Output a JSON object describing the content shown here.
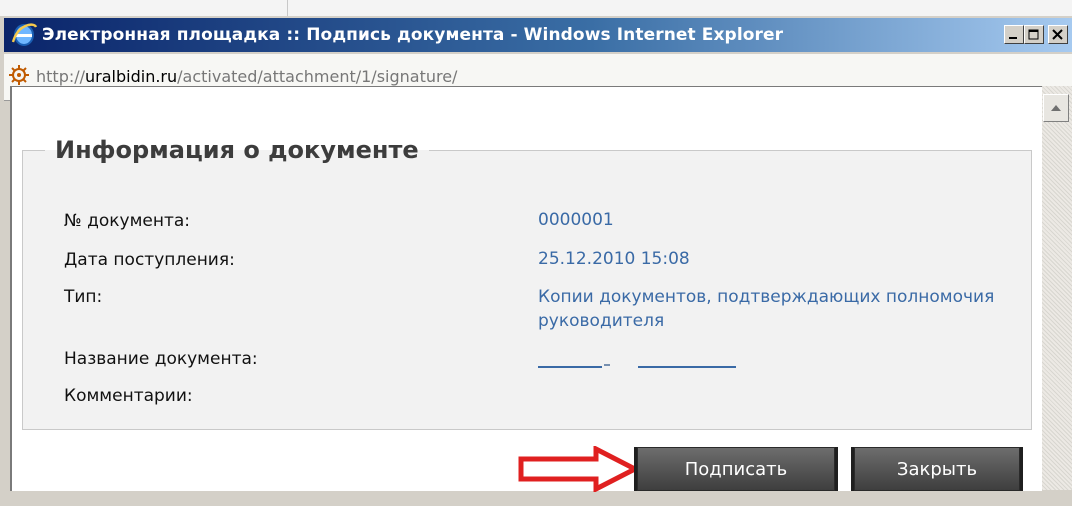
{
  "window": {
    "title": "Электронная площадка :: Подпись документа - Windows Internet Explorer",
    "url_prefix": "http://",
    "url_domain": "uralbidin.ru",
    "url_path": "/activated/attachment/1/signature/"
  },
  "section": {
    "legend": "Информация о документе",
    "fields": [
      {
        "label": "№ документа:",
        "value": "0000001"
      },
      {
        "label": "Дата поступления:",
        "value": "25.12.2010 15:08"
      },
      {
        "label": "Тип:",
        "value": "Копии документов, подтверждающих полномочия руководителя"
      },
      {
        "label": "Название документа:",
        "value": ""
      },
      {
        "label": "Комментарии:",
        "value": ""
      }
    ]
  },
  "buttons": {
    "sign": "Подписать",
    "close": "Закрыть"
  },
  "colors": {
    "accent_link": "#3a6aa6",
    "arrow_annotation": "#e02020",
    "button_dark": "#4a4a4a"
  }
}
